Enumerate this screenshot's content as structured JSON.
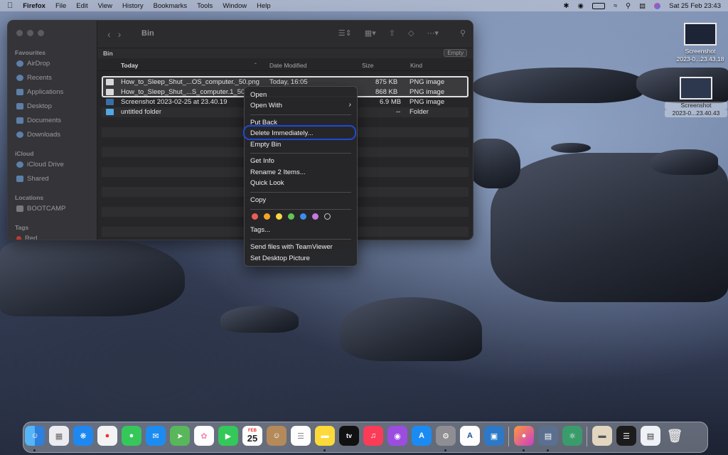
{
  "menubar": {
    "apple": "",
    "items": [
      "Firefox",
      "File",
      "Edit",
      "View",
      "History",
      "Bookmarks",
      "Tools",
      "Window",
      "Help"
    ],
    "datetime": "Sat 25 Feb  23:43"
  },
  "finder": {
    "title": "Bin",
    "path_label": "Bin",
    "empty_button": "Empty",
    "sidebar": {
      "favourites_header": "Favourites",
      "favourites": [
        "AirDrop",
        "Recents",
        "Applications",
        "Desktop",
        "Documents",
        "Downloads"
      ],
      "icloud_header": "iCloud",
      "icloud": [
        "iCloud Drive",
        "Shared"
      ],
      "locations_header": "Locations",
      "locations": [
        "BOOTCAMP"
      ],
      "tags_header": "Tags",
      "tags": [
        "Red"
      ]
    },
    "columns": {
      "name": "Today",
      "modified": "Date Modified",
      "size": "Size",
      "kind": "Kind"
    },
    "files": [
      {
        "name": "How_to_Sleep_Shut_...OS_computer._50.png",
        "modified": "Today, 16:05",
        "size": "875 KB",
        "kind": "PNG image"
      },
      {
        "name": "How_to_Sleep_Shut_...S_computer.1_50",
        "modified": "",
        "size": "868 KB",
        "kind": "PNG image"
      },
      {
        "name": "Screenshot 2023-02-25 at 23.40.19",
        "modified": "",
        "size": "6.9 MB",
        "kind": "PNG image"
      },
      {
        "name": "untitled folder",
        "modified": "",
        "size": "--",
        "kind": "Folder"
      }
    ]
  },
  "context_menu": {
    "open": "Open",
    "open_with": "Open With",
    "put_back": "Put Back",
    "delete_immediately": "Delete Immediately...",
    "empty_bin": "Empty Bin",
    "get_info": "Get Info",
    "rename": "Rename 2 Items...",
    "quick_look": "Quick Look",
    "copy": "Copy",
    "tag_colors": [
      "#ec5d57",
      "#f5a623",
      "#f8d743",
      "#61c554",
      "#3b8ef0",
      "#c678dd",
      "#8e8e93"
    ],
    "tags": "Tags...",
    "teamviewer": "Send files with TeamViewer",
    "set_desktop": "Set Desktop Picture"
  },
  "desktop": {
    "screenshot1": {
      "line1": "Screenshot",
      "line2": "2023-0...23.43.18"
    },
    "screenshot2": {
      "line1": "Screenshot",
      "line2": "2023-0...23.40.43"
    }
  },
  "dock": {
    "calendar_month": "FEB",
    "calendar_day": "25",
    "tv": "tv"
  }
}
